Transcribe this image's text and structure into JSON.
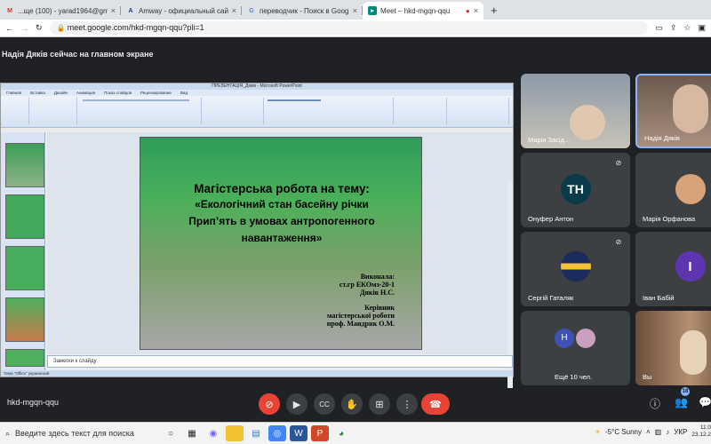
{
  "tabs": [
    {
      "title": "...ще (100) - yarad1964@gm",
      "icon": "gmail-icon",
      "color": "#d93025"
    },
    {
      "title": "Amway - официальный сайт и",
      "icon": "amway-icon",
      "color": "#1a3d8f"
    },
    {
      "title": "переводчик - Поиск в Google",
      "icon": "google-icon",
      "color": "#4285f4"
    },
    {
      "title": "Meet – hkd-mgqn-qqu",
      "icon": "meet-icon",
      "color": "#00897b"
    }
  ],
  "new_tab": "+",
  "address": {
    "url": "meet.google.com/hkd-mgqn-qqu?pli=1"
  },
  "banner": "Надія Дяків сейчас на главном экране",
  "presentation": {
    "window_title": "ПРЕЗЕНТАЦІЯ_Дяків - Microsoft PowerPoint",
    "menu": [
      "Главная",
      "Вставка",
      "Дизайн",
      "Анимация",
      "Показ слайдов",
      "Рецензирование",
      "Вид"
    ],
    "slide": {
      "title_line1": "Магістерська робота на тему:",
      "title_line2": "«Екологічний стан басейну річки",
      "title_line3": "Прип’ять в умовах антропогенного",
      "title_line4": "навантаження»",
      "author": [
        "Виконала:",
        "ст.гр ЕКОмз-20-1",
        "Дяків Н.С.",
        "",
        "Керівник",
        "магістерської роботи",
        "проф. Мандрик О.М."
      ]
    },
    "notes_placeholder": "Заметки к слайду",
    "status": "Тема \"Office\"   украинский"
  },
  "participants": [
    {
      "name": "Марія Засід...",
      "muted": false
    },
    {
      "name": "Надія Дяків",
      "muted": false
    },
    {
      "name": "Онуфер Антон",
      "muted": true,
      "initials": "TH"
    },
    {
      "name": "Марія Орфанова",
      "muted": true
    },
    {
      "name": "Сергій Гаталяк",
      "muted": true
    },
    {
      "name": "Іван Бабій",
      "muted": true,
      "initials": "I"
    },
    {
      "name": "Ещё 10 чел.",
      "muted": false,
      "initials": "H"
    },
    {
      "name": "Вы",
      "muted": false
    }
  ],
  "controls": {
    "meeting_code": "hkd-mgqn-qqu",
    "people_count": "18"
  },
  "taskbar": {
    "search_placeholder": "Введите здесь текст для поиска",
    "weather": "-5°C  Sunny",
    "language": "УКР",
    "time": "11:0",
    "date": "23.12.2"
  }
}
